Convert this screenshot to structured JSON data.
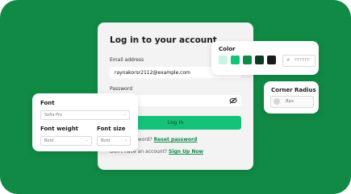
{
  "login": {
    "title": "Log in to your account",
    "email_label": "Email address",
    "email_value": "raynakorsr2112@example.com",
    "password_label": "Password",
    "password_value": "••••",
    "login_button": "Log In",
    "forgot_text": "Forgot password?",
    "reset_link": "Reset password",
    "no_account_text": "Don't have an account?",
    "signup_link": "Sign Up Now"
  },
  "font_panel": {
    "font_label": "Font",
    "font_value": "Sofia Pro",
    "weight_label": "Font weight",
    "weight_value": "Bold",
    "size_label": "Font size",
    "size_value": "Bold"
  },
  "color_panel": {
    "title": "Color",
    "swatches": [
      "#c8f5df",
      "#14c27a",
      "#0e8a46",
      "#0c3b25",
      "#1a1a1a"
    ],
    "hex_prefix": "#",
    "hex_value": "FFFFFF"
  },
  "radius_panel": {
    "title": "Corner Radius",
    "value": "8px"
  },
  "icons": {
    "eye": "eye-off-icon",
    "chevron": "chevron-down-icon",
    "radius": "corner-radius-icon"
  }
}
